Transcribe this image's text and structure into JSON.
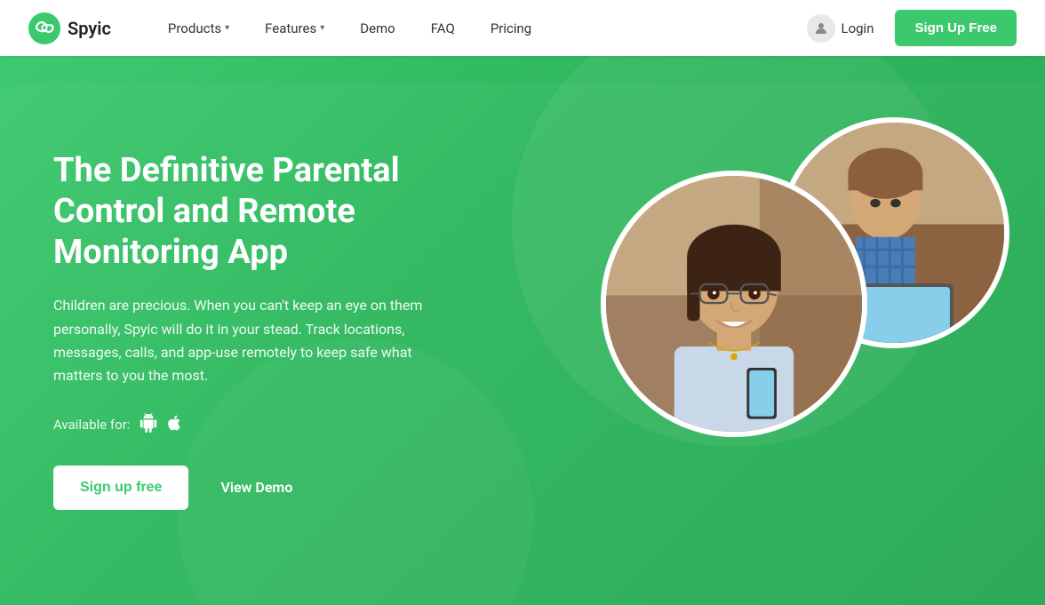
{
  "brand": {
    "name": "Spyic",
    "logo_alt": "Spyic logo"
  },
  "navbar": {
    "links": [
      {
        "label": "Products",
        "has_dropdown": true,
        "id": "products"
      },
      {
        "label": "Features",
        "has_dropdown": true,
        "id": "features"
      },
      {
        "label": "Demo",
        "has_dropdown": false,
        "id": "demo"
      },
      {
        "label": "FAQ",
        "has_dropdown": false,
        "id": "faq"
      },
      {
        "label": "Pricing",
        "has_dropdown": false,
        "id": "pricing"
      }
    ],
    "login_label": "Login",
    "signup_label": "Sign Up Free"
  },
  "hero": {
    "title": "The Definitive Parental Control and Remote Monitoring App",
    "description": "Children are precious. When you can't keep an eye on them personally, Spyic will do it in your stead. Track locations, messages, calls, and app-use remotely to keep safe what matters to you the most.",
    "available_for_label": "Available for:",
    "cta_primary": "Sign up free",
    "cta_secondary": "View Demo",
    "platforms": [
      "android",
      "apple"
    ]
  },
  "colors": {
    "green_primary": "#3cc96e",
    "green_dark": "#2ea85a",
    "white": "#ffffff"
  }
}
